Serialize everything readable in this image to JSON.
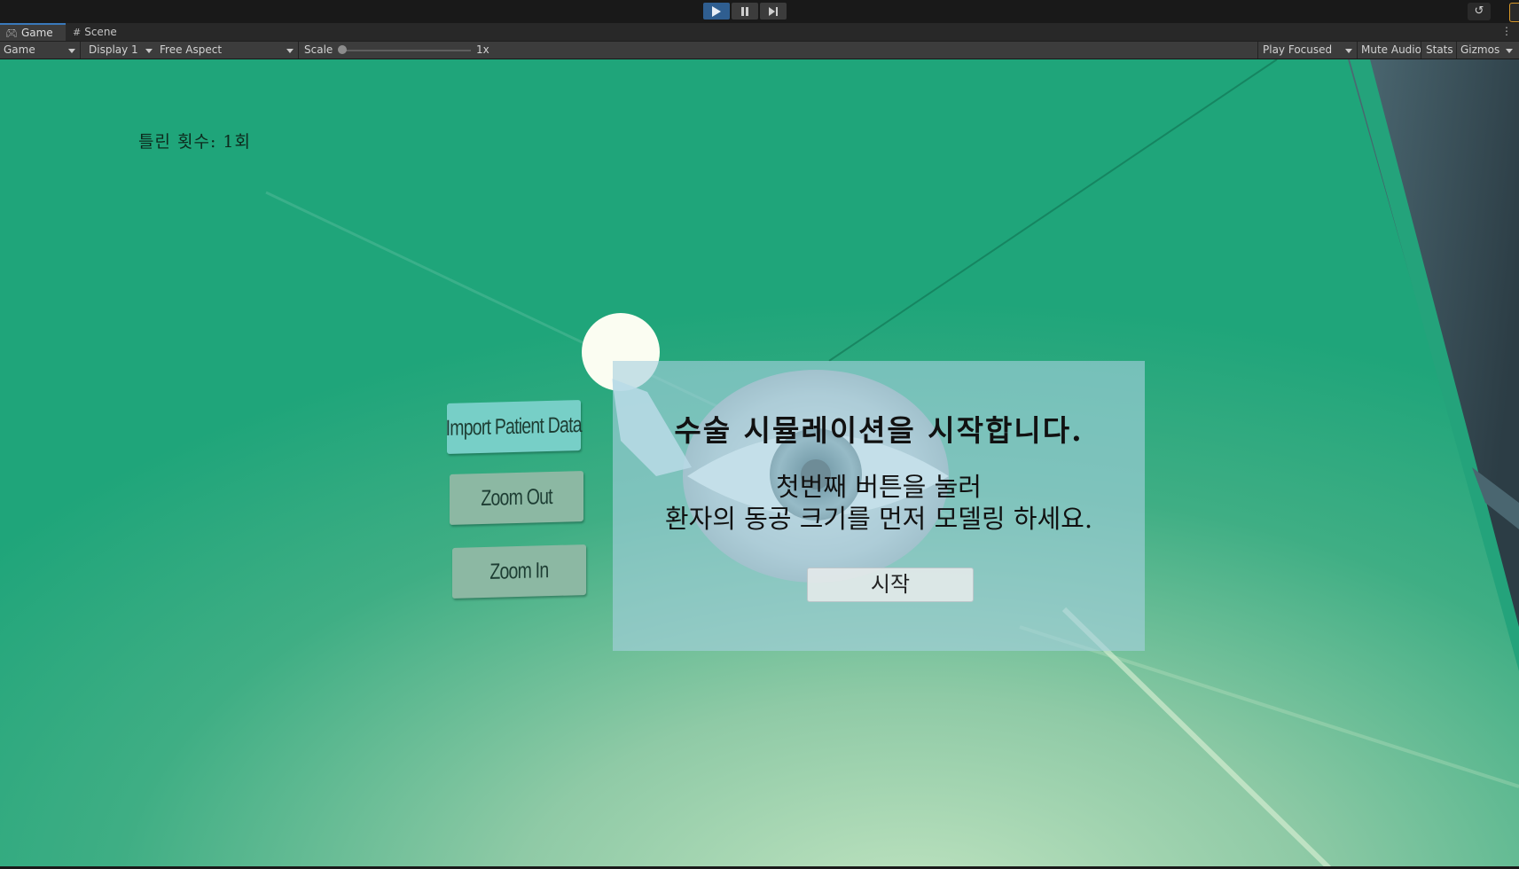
{
  "play_controls": {
    "play": "play-icon",
    "pause": "pause-icon",
    "step": "step-icon"
  },
  "tabs": [
    {
      "label": "Game",
      "icon": "gamepad-icon",
      "active": true
    },
    {
      "label": "Scene",
      "icon": "grid-icon",
      "active": false
    }
  ],
  "toolbar": {
    "game_dropdown": "Game",
    "display_dropdown": "Display 1",
    "aspect_dropdown": "Free Aspect",
    "scale_label": "Scale",
    "scale_value": "1x",
    "scale_level": 0,
    "play_mode_dropdown": "Play Focused",
    "mute_audio": "Mute Audio",
    "stats": "Stats",
    "gizmos": "Gizmos"
  },
  "game_view": {
    "wrong_count": "틀린 횟수: 1회",
    "buttons": {
      "import": "Import Patient Data",
      "zoom_out": "Zoom Out",
      "zoom_in": "Zoom In"
    },
    "dialog": {
      "title": "수술 시뮬레이션을 시작합니다.",
      "line1": "첫번째 버튼을 눌러",
      "line2": "환자의 동공 크기를 먼저 모델링 하세요.",
      "start_button": "시작"
    }
  },
  "colors": {
    "editor_bg": "#191919",
    "toolbar_bg": "#3c3c3c",
    "play_active": "#2f5e90",
    "scene_green": "#1fa57a",
    "dialog_bg": "#a6d1de"
  }
}
